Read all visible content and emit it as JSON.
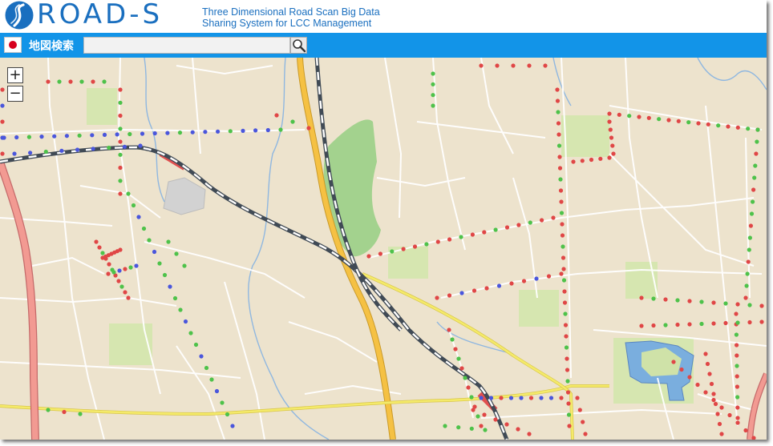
{
  "header": {
    "logo_text": "ROAD-S",
    "tagline_line1": "Three Dimensional Road Scan Big Data",
    "tagline_line2": "Sharing System for LCC Management",
    "brand_color": "#1a6fbf"
  },
  "search": {
    "label": "地図検索",
    "value": "",
    "bar_color": "#1294e8",
    "flag_icon": "japan-flag-icon",
    "button_icon": "magnifier-icon"
  },
  "map": {
    "zoom_in_label": "+",
    "zoom_out_label": "−",
    "marker_colors": {
      "red": "#e04646",
      "green": "#4ec24a",
      "blue": "#4a56dc"
    }
  }
}
